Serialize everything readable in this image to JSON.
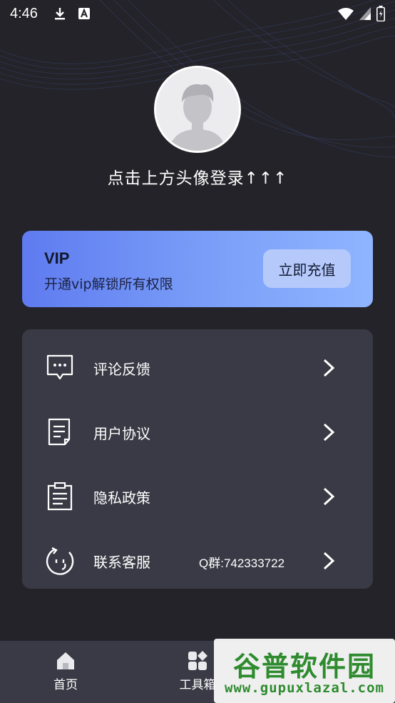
{
  "status_bar": {
    "time": "4:46",
    "left_icons": [
      "download-icon",
      "a-badge-icon"
    ],
    "right_icons": [
      "wifi-icon",
      "signal-icon",
      "battery-icon"
    ]
  },
  "profile": {
    "avatar": "default-avatar",
    "login_prompt": "点击上方头像登录↑↑↑"
  },
  "vip": {
    "title": "VIP",
    "subtitle": "开通vip解锁所有权限",
    "button_label": "立即充值",
    "gradient": [
      "#5f7bf0",
      "#8fb5ff"
    ]
  },
  "menu": {
    "items": [
      {
        "icon": "feedback-icon",
        "label": "评论反馈",
        "extra": ""
      },
      {
        "icon": "document-icon",
        "label": "用户协议",
        "extra": ""
      },
      {
        "icon": "clipboard-icon",
        "label": "隐私政策",
        "extra": ""
      },
      {
        "icon": "service-icon",
        "label": "联系客服",
        "extra": "Q群:742333722"
      }
    ]
  },
  "bottom_nav": {
    "items": [
      {
        "icon": "home-icon",
        "label": "首页"
      },
      {
        "icon": "toolbox-icon",
        "label": "工具箱"
      }
    ]
  },
  "watermark": {
    "title": "谷普软件园",
    "url": "www.gupuxlazal.com"
  },
  "colors": {
    "background": "#232329",
    "card": "#3a3a46",
    "watermark_green": "#2e8b2e"
  }
}
